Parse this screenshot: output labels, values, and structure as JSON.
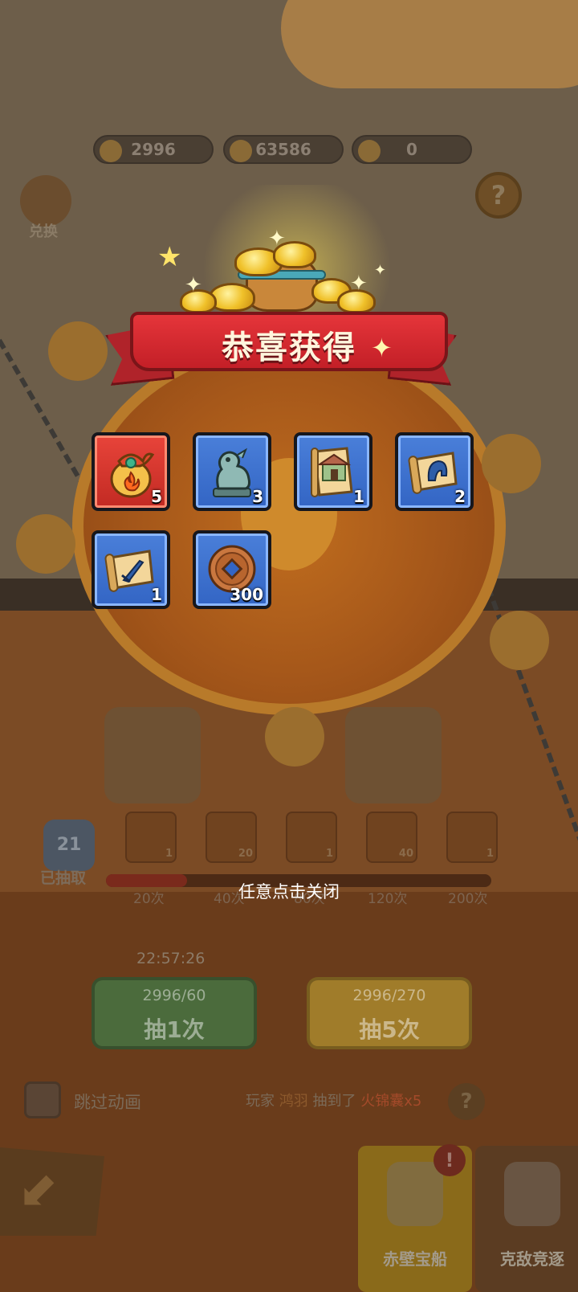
{
  "currencies": [
    {
      "name": "ingot",
      "value": "2996"
    },
    {
      "name": "copper-coin",
      "value": "63586"
    },
    {
      "name": "token",
      "value": "0"
    }
  ],
  "exchange_label": "兑换",
  "help_glyph": "?",
  "popup": {
    "title": "恭喜获得",
    "items": [
      {
        "icon": "fire-pouch-icon",
        "count": "5",
        "frame": "red"
      },
      {
        "icon": "jade-pixiu-statue-icon",
        "count": "3",
        "frame": "blue"
      },
      {
        "icon": "building-scroll-icon",
        "count": "1",
        "frame": "blue"
      },
      {
        "icon": "helmet-scroll-icon",
        "count": "2",
        "frame": "blue"
      },
      {
        "icon": "sword-scroll-icon",
        "count": "1",
        "frame": "blue"
      },
      {
        "icon": "copper-coin-icon",
        "count": "300",
        "frame": "blue"
      }
    ],
    "close_hint": "任意点击关闭"
  },
  "draw_progress": {
    "count": "21",
    "label": "已抽取",
    "fraction": 0.21,
    "milestones": [
      "20次",
      "40次",
      "80次",
      "120次",
      "200次"
    ],
    "reward_counts": [
      "1",
      "20",
      "1",
      "40",
      "1"
    ]
  },
  "timer": "22:57:26",
  "draw_buttons": [
    {
      "cost": "2996/60",
      "label": "抽1次",
      "color": "green"
    },
    {
      "cost": "2996/270",
      "label": "抽5次",
      "color": "gold"
    }
  ],
  "skip_animation_label": "跳过动画",
  "broadcast": {
    "prefix": "玩家",
    "player": "鸿羽",
    "verb": "抽到了",
    "item": "火锦囊x5"
  },
  "bottom_tabs": [
    {
      "label": "赤壁宝船",
      "active": true
    },
    {
      "label": "克敌竞逐",
      "active": false
    }
  ],
  "notice_glyph": "!",
  "colors": {
    "banner_red": "#c31f27",
    "card_blue": "#3365c4",
    "card_red": "#c22a23",
    "overlay": "#3a2f25"
  }
}
